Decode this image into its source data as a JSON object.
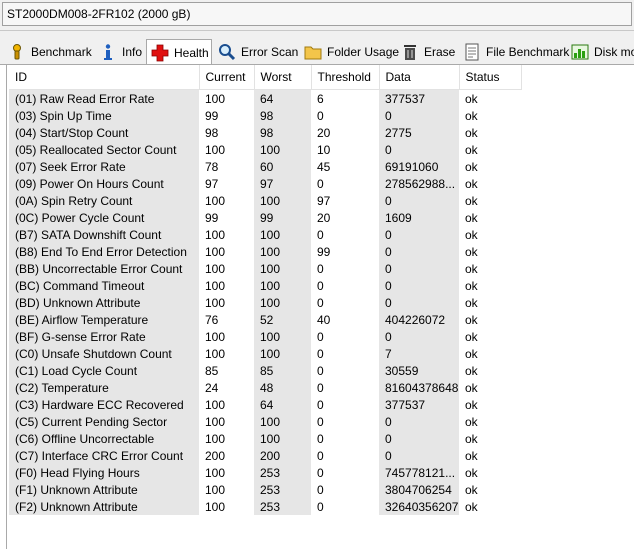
{
  "window": {
    "drive": "ST2000DM008-2FR102 (2000 gB)"
  },
  "tabs": [
    {
      "label": "Benchmark",
      "icon": "benchmark-icon"
    },
    {
      "label": "Info",
      "icon": "info-icon"
    },
    {
      "label": "Health",
      "icon": "health-cross-icon"
    },
    {
      "label": "Error Scan",
      "icon": "magnifier-icon"
    },
    {
      "label": "Folder Usage",
      "icon": "folder-icon"
    },
    {
      "label": "Erase",
      "icon": "trash-icon"
    },
    {
      "label": "File Benchmark",
      "icon": "file-benchmark-icon"
    },
    {
      "label": "Disk mon",
      "icon": "disk-monitor-icon"
    }
  ],
  "columns": [
    "ID",
    "Current",
    "Worst",
    "Threshold",
    "Data",
    "Status"
  ],
  "rows": [
    [
      "(01) Raw Read Error Rate",
      "100",
      "64",
      "6",
      "377537",
      "ok"
    ],
    [
      "(03) Spin Up Time",
      "99",
      "98",
      "0",
      "0",
      "ok"
    ],
    [
      "(04) Start/Stop Count",
      "98",
      "98",
      "20",
      "2775",
      "ok"
    ],
    [
      "(05) Reallocated Sector Count",
      "100",
      "100",
      "10",
      "0",
      "ok"
    ],
    [
      "(07) Seek Error Rate",
      "78",
      "60",
      "45",
      "69191060",
      "ok"
    ],
    [
      "(09) Power On Hours Count",
      "97",
      "97",
      "0",
      "278562988...",
      "ok"
    ],
    [
      "(0A) Spin Retry Count",
      "100",
      "100",
      "97",
      "0",
      "ok"
    ],
    [
      "(0C) Power Cycle Count",
      "99",
      "99",
      "20",
      "1609",
      "ok"
    ],
    [
      "(B7) SATA Downshift Count",
      "100",
      "100",
      "0",
      "0",
      "ok"
    ],
    [
      "(B8) End To End Error Detection",
      "100",
      "100",
      "99",
      "0",
      "ok"
    ],
    [
      "(BB) Uncorrectable Error Count",
      "100",
      "100",
      "0",
      "0",
      "ok"
    ],
    [
      "(BC) Command Timeout",
      "100",
      "100",
      "0",
      "0",
      "ok"
    ],
    [
      "(BD) Unknown Attribute",
      "100",
      "100",
      "0",
      "0",
      "ok"
    ],
    [
      "(BE) Airflow Temperature",
      "76",
      "52",
      "40",
      "404226072",
      "ok"
    ],
    [
      "(BF) G-sense Error Rate",
      "100",
      "100",
      "0",
      "0",
      "ok"
    ],
    [
      "(C0) Unsafe Shutdown Count",
      "100",
      "100",
      "0",
      "7",
      "ok"
    ],
    [
      "(C1) Load Cycle Count",
      "85",
      "85",
      "0",
      "30559",
      "ok"
    ],
    [
      "(C2) Temperature",
      "24",
      "48",
      "0",
      "81604378648",
      "ok"
    ],
    [
      "(C3) Hardware ECC Recovered",
      "100",
      "64",
      "0",
      "377537",
      "ok"
    ],
    [
      "(C5) Current Pending Sector",
      "100",
      "100",
      "0",
      "0",
      "ok"
    ],
    [
      "(C6) Offline Uncorrectable",
      "100",
      "100",
      "0",
      "0",
      "ok"
    ],
    [
      "(C7) Interface CRC Error Count",
      "200",
      "200",
      "0",
      "0",
      "ok"
    ],
    [
      "(F0) Head Flying Hours",
      "100",
      "253",
      "0",
      "745778121...",
      "ok"
    ],
    [
      "(F1) Unknown Attribute",
      "100",
      "253",
      "0",
      "3804706254",
      "ok"
    ],
    [
      "(F2) Unknown Attribute",
      "100",
      "253",
      "0",
      "32640356207",
      "ok"
    ]
  ]
}
